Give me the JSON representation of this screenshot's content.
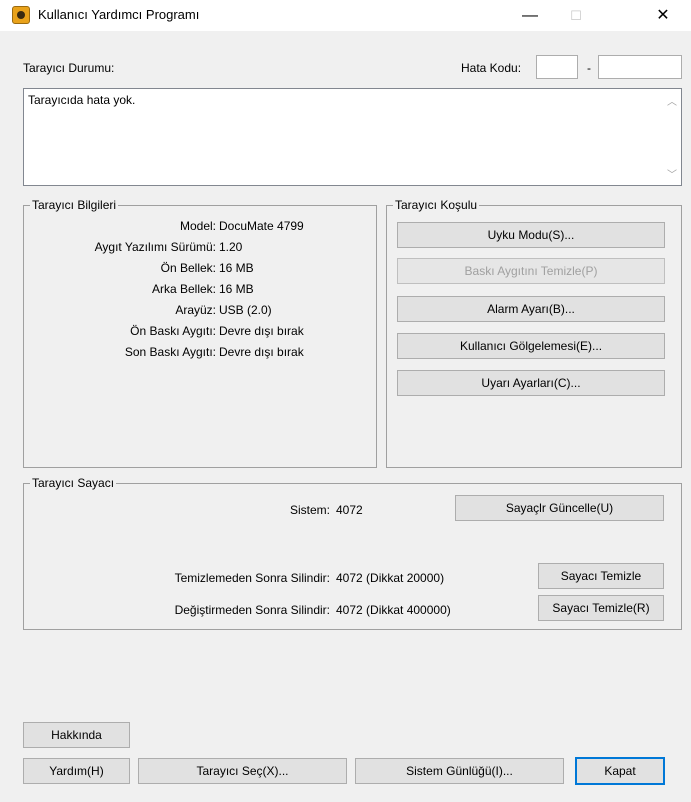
{
  "window": {
    "title": "Kullanıcı Yardımcı Programı",
    "minimize": "—",
    "maximize": "☐",
    "close": "✕"
  },
  "status": {
    "label": "Tarayıcı Durumu:",
    "error_code_label": "Hata Kodu:",
    "error_code_1": "",
    "error_code_sep": "-",
    "error_code_2": "",
    "message": "Tarayıcıda hata yok."
  },
  "info": {
    "title": "Tarayıcı Bilgileri",
    "rows": [
      {
        "label": "Model:",
        "value": "DocuMate 4799"
      },
      {
        "label": "Aygıt Yazılımı Sürümü:",
        "value": "1.20"
      },
      {
        "label": "Ön Bellek:",
        "value": "16 MB"
      },
      {
        "label": "Arka Bellek:",
        "value": "16 MB"
      },
      {
        "label": "Arayüz:",
        "value": "USB (2.0)"
      },
      {
        "label": "Ön Baskı Aygıtı:",
        "value": "Devre dışı bırak"
      },
      {
        "label": "Son Baskı Aygıtı:",
        "value": "Devre dışı bırak"
      }
    ]
  },
  "condition": {
    "title": "Tarayıcı Koşulu",
    "buttons": [
      {
        "label": "Uyku Modu(S)...",
        "enabled": true
      },
      {
        "label": "Baskı Aygıtını Temizle(P)",
        "enabled": false
      },
      {
        "label": "Alarm Ayarı(B)...",
        "enabled": true
      },
      {
        "label": "Kullanıcı Gölgelemesi(E)...",
        "enabled": true
      },
      {
        "label": "Uyarı Ayarları(C)...",
        "enabled": true
      }
    ]
  },
  "counter": {
    "title": "Tarayıcı Sayacı",
    "system_label": "Sistem:",
    "system_value": "4072",
    "update_button": "Sayaçlr Güncelle(U)",
    "after_clean_label": "Temizlemeden Sonra Silindir:",
    "after_clean_value": "4072 (Dikkat 20000)",
    "clear_button_1": "Sayacı Temizle",
    "after_replace_label": "Değiştirmeden Sonra Silindir:",
    "after_replace_value": "4072 (Dikkat 400000)",
    "clear_button_2": "Sayacı Temizle(R)"
  },
  "footer": {
    "about": "Hakkında",
    "help": "Yardım(H)",
    "select_scanner": "Tarayıcı Seç(X)...",
    "system_log": "Sistem Günlüğü(I)...",
    "close": "Kapat"
  }
}
